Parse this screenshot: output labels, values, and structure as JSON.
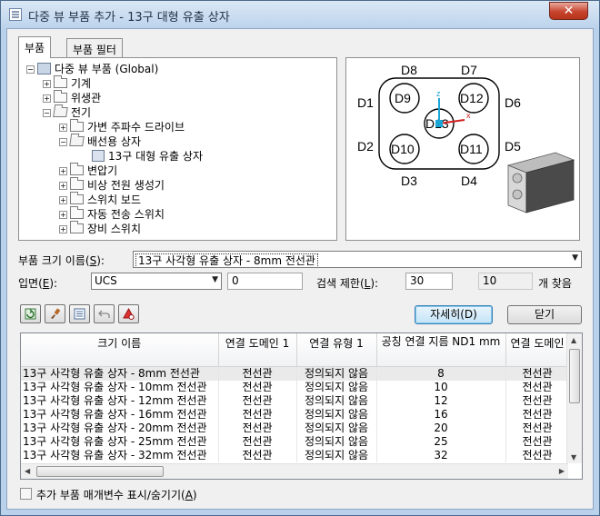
{
  "window": {
    "title": "다중 뷰 부품 추가 - 13구 대형 유출 상자",
    "close_glyph": "✕"
  },
  "tabs": [
    {
      "label": "부품",
      "active": true
    },
    {
      "label": "부품 필터",
      "active": false
    }
  ],
  "tree": {
    "items": [
      {
        "label": "다중 뷰 부품 (Global)",
        "expander": "−"
      },
      {
        "label": "기계",
        "expander": "+"
      },
      {
        "label": "위생관",
        "expander": "+"
      },
      {
        "label": "전기",
        "expander": "−"
      },
      {
        "label": "가변 주파수 드라이브",
        "expander": "+"
      },
      {
        "label": "배선용 상자",
        "expander": "−"
      },
      {
        "label": "13구 대형 유출 상자",
        "expander": ""
      },
      {
        "label": "변압기",
        "expander": "+"
      },
      {
        "label": "비상 전원 생성기",
        "expander": "+"
      },
      {
        "label": "스위치 보드",
        "expander": "+"
      },
      {
        "label": "자동 전송 스위치",
        "expander": "+"
      },
      {
        "label": "장비 스위치",
        "expander": "+"
      }
    ]
  },
  "preview": {
    "outer_labels": [
      "D8",
      "D7",
      "D1",
      "D6",
      "D2",
      "D5",
      "D3",
      "D4"
    ],
    "circle_labels": [
      "D9",
      "D12",
      "D13",
      "D10",
      "D11"
    ],
    "axis_z": "z",
    "axis_x": "x"
  },
  "size_name": {
    "label": "부품 크기 이름(S):",
    "value": "13구 사각형 유출 상자 - 8mm 전선관"
  },
  "elevation": {
    "label": "입면(E):",
    "ucs_value": "UCS",
    "value": "0"
  },
  "search_limit": {
    "label": "검색 제한(L):",
    "value": "30",
    "found_count": "10",
    "found_suffix": "개 찾음"
  },
  "buttons": {
    "details": "자세히(D)",
    "close": "닫기"
  },
  "grid": {
    "columns": [
      "크기 이름",
      "연결 도메인 1",
      "연결 유형 1",
      "공칭 연결 지름 ND1 mm",
      "연결 도메인"
    ],
    "rows": [
      [
        "13구 사각형 유출 상자 - 8mm 전선관",
        "전선관",
        "정의되지 않음",
        "8",
        "전선관"
      ],
      [
        "13구 사각형 유출 상자 - 10mm 전선관",
        "전선관",
        "정의되지 않음",
        "10",
        "전선관"
      ],
      [
        "13구 사각형 유출 상자 - 12mm 전선관",
        "전선관",
        "정의되지 않음",
        "12",
        "전선관"
      ],
      [
        "13구 사각형 유출 상자 - 16mm 전선관",
        "전선관",
        "정의되지 않음",
        "16",
        "전선관"
      ],
      [
        "13구 사각형 유출 상자 - 20mm 전선관",
        "전선관",
        "정의되지 않음",
        "20",
        "전선관"
      ],
      [
        "13구 사각형 유출 상자 - 25mm 전선관",
        "전선관",
        "정의되지 않음",
        "25",
        "전선관"
      ],
      [
        "13구 사각형 유출 상자 - 32mm 전선관",
        "전선관",
        "정의되지 않음",
        "32",
        "전선관"
      ]
    ]
  },
  "show_params": {
    "label": "추가 부품 매개변수 표시/숨기기(A)",
    "checked": false
  }
}
